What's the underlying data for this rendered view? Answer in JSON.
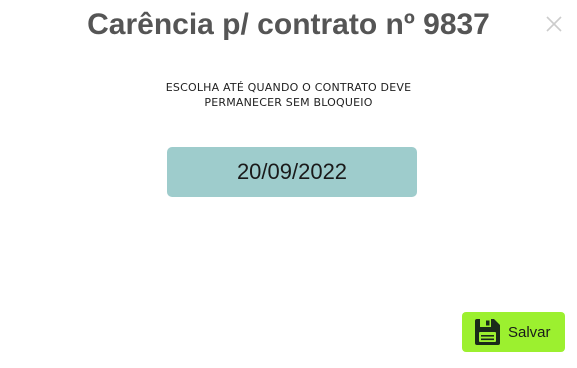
{
  "dialog": {
    "title": "Carência p/ contrato nº 9837",
    "instruction_line1": "ESCOLHA ATÉ QUANDO O CONTRATO DEVE",
    "instruction_line2": "PERMANECER SEM BLOQUEIO",
    "date_value": "20/09/2022",
    "close_icon": "close-icon",
    "save_label": "Salvar",
    "save_icon": "floppy-disk-icon",
    "colors": {
      "title": "#555555",
      "date_field_bg": "#9ecccc",
      "save_button_bg": "#9cf02f",
      "close_icon": "#cccccc"
    }
  }
}
